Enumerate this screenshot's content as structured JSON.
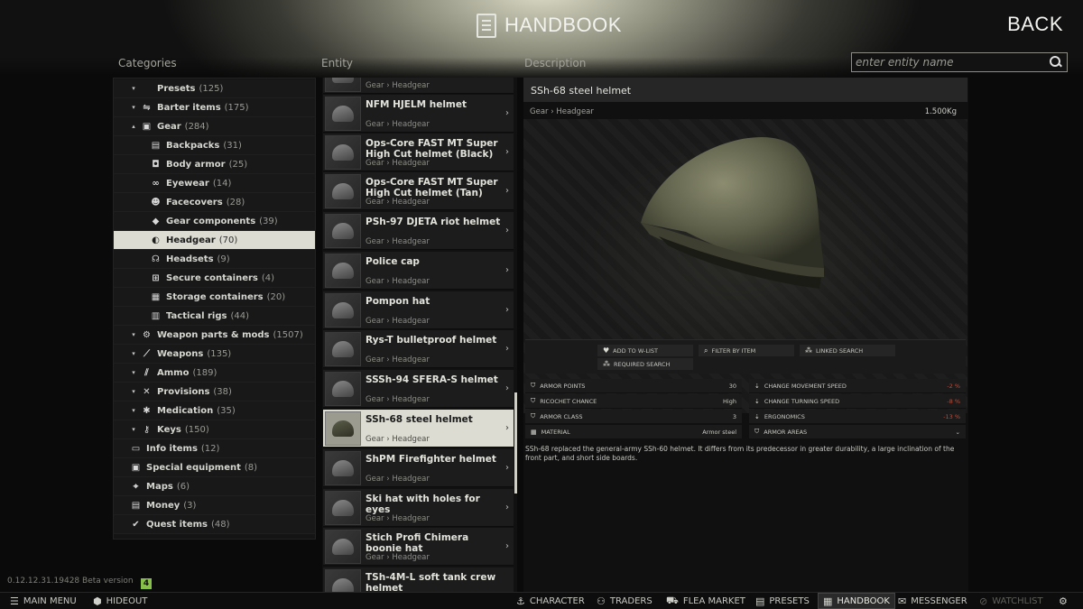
{
  "header": {
    "title": "HANDBOOK",
    "back_label": "BACK"
  },
  "columns": {
    "categories": "Categories",
    "entity": "Entity",
    "description": "Description"
  },
  "search": {
    "placeholder": "enter entity name"
  },
  "categories": [
    {
      "name": "Presets",
      "count": "(125)",
      "arrow": "▾",
      "icon": "preset-icon"
    },
    {
      "name": "Barter items",
      "count": "(175)",
      "arrow": "▾",
      "icon": "barter-icon"
    },
    {
      "name": "Gear",
      "count": "(284)",
      "arrow": "▴",
      "icon": "gear-icon"
    },
    {
      "name": "Backpacks",
      "count": "(31)",
      "icon": "backpack-icon"
    },
    {
      "name": "Body armor",
      "count": "(25)",
      "icon": "body-armor-icon"
    },
    {
      "name": "Eyewear",
      "count": "(14)",
      "icon": "eyewear-icon"
    },
    {
      "name": "Facecovers",
      "count": "(28)",
      "icon": "facecover-icon"
    },
    {
      "name": "Gear components",
      "count": "(39)",
      "icon": "gear-component-icon"
    },
    {
      "name": "Headgear",
      "count": "(70)",
      "icon": "headgear-icon"
    },
    {
      "name": "Headsets",
      "count": "(9)",
      "icon": "headset-icon"
    },
    {
      "name": "Secure containers",
      "count": "(4)",
      "icon": "secure-container-icon"
    },
    {
      "name": "Storage containers",
      "count": "(20)",
      "icon": "storage-container-icon"
    },
    {
      "name": "Tactical rigs",
      "count": "(44)",
      "icon": "tactical-rig-icon"
    },
    {
      "name": "Weapon parts & mods",
      "count": "(1507)",
      "arrow": "▾",
      "icon": "weapon-parts-icon"
    },
    {
      "name": "Weapons",
      "count": "(135)",
      "arrow": "▾",
      "icon": "weapon-icon"
    },
    {
      "name": "Ammo",
      "count": "(189)",
      "arrow": "▾",
      "icon": "ammo-icon"
    },
    {
      "name": "Provisions",
      "count": "(38)",
      "arrow": "▾",
      "icon": "provisions-icon"
    },
    {
      "name": "Medication",
      "count": "(35)",
      "arrow": "▾",
      "icon": "medication-icon"
    },
    {
      "name": "Keys",
      "count": "(150)",
      "arrow": "▾",
      "icon": "key-icon"
    },
    {
      "name": "Info items",
      "count": "(12)",
      "icon": "info-item-icon"
    },
    {
      "name": "Special equipment",
      "count": "(8)",
      "icon": "special-equipment-icon"
    },
    {
      "name": "Maps",
      "count": "(6)",
      "icon": "map-icon"
    },
    {
      "name": "Money",
      "count": "(3)",
      "icon": "money-icon"
    },
    {
      "name": "Quest items",
      "count": "(48)",
      "icon": "quest-item-icon"
    }
  ],
  "entities": [
    {
      "name": "",
      "sub": "Gear › Headgear"
    },
    {
      "name": "NFM HJELM helmet",
      "sub": "Gear › Headgear"
    },
    {
      "name": "Ops-Core FAST MT Super High Cut helmet (Black)",
      "sub": "Gear › Headgear"
    },
    {
      "name": "Ops-Core FAST MT Super High Cut helmet (Tan)",
      "sub": "Gear › Headgear"
    },
    {
      "name": "PSh-97 DJETA riot helmet",
      "sub": "Gear › Headgear"
    },
    {
      "name": "Police cap",
      "sub": "Gear › Headgear"
    },
    {
      "name": "Pompon hat",
      "sub": "Gear › Headgear"
    },
    {
      "name": "Rys-T bulletproof helmet",
      "sub": "Gear › Headgear"
    },
    {
      "name": "SSSh-94 SFERA-S helmet",
      "sub": "Gear › Headgear"
    },
    {
      "name": "SSh-68 steel helmet",
      "sub": "Gear › Headgear"
    },
    {
      "name": "ShPM Firefighter helmet",
      "sub": "Gear › Headgear"
    },
    {
      "name": "Ski hat with holes for eyes",
      "sub": "Gear › Headgear"
    },
    {
      "name": "Stich Profi Chimera boonie hat",
      "sub": "Gear › Headgear"
    },
    {
      "name": "TSh-4M-L soft tank crew helmet",
      "sub": ""
    }
  ],
  "detail": {
    "title": "SSh-68 steel helmet",
    "path": "Gear › Headgear",
    "weight": "1.500Kg",
    "actions": {
      "wishlist": "ADD TO W-LIST",
      "filter": "FILTER BY ITEM",
      "linked": "LINKED SEARCH",
      "required": "REQUIRED SEARCH"
    },
    "stats_left": [
      {
        "label": "ARMOR POINTS",
        "value": "30"
      },
      {
        "label": "RICOCHET CHANCE",
        "value": "High"
      },
      {
        "label": "ARMOR CLASS",
        "value": "3"
      },
      {
        "label": "MATERIAL",
        "value": "Armor steel"
      }
    ],
    "stats_right": [
      {
        "label": "CHANGE MOVEMENT SPEED",
        "value": "-2 %"
      },
      {
        "label": "CHANGE TURNING SPEED",
        "value": "-8 %"
      },
      {
        "label": "ERGONOMICS",
        "value": "-13 %"
      },
      {
        "label": "ARMOR AREAS",
        "value": "⌄"
      }
    ],
    "description": "SSh-68 replaced the general-army SSh-60 helmet. It differs from its predecessor in greater durability, a large inclination of the front part, and short side boards."
  },
  "version": {
    "text": "0.12.12.31.19428 Beta version",
    "badge": "4"
  },
  "taskbar": {
    "main_menu": "MAIN MENU",
    "hideout": "HIDEOUT",
    "character": "CHARACTER",
    "traders": "TRADERS",
    "flea_market": "FLEA MARKET",
    "presets": "PRESETS",
    "handbook": "HANDBOOK",
    "messenger": "MESSENGER",
    "watchlist": "WATCHLIST"
  },
  "colors": {
    "accent_selected": "#dcdcd2",
    "negative": "#c04a38",
    "version_badge": "#86c04a"
  }
}
